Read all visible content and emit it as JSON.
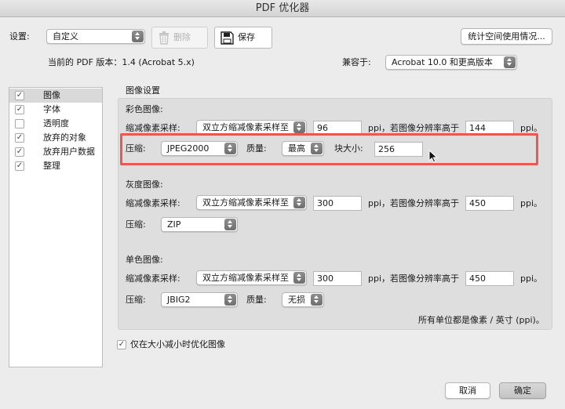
{
  "window": {
    "title": "PDF 优化器"
  },
  "settings": {
    "label": "设置:",
    "value": "自定义",
    "delete_label": "删除",
    "save_label": "保存",
    "audit_button": "统计空间使用情况..."
  },
  "version": {
    "current_text": "当前的 PDF 版本：1.4 (Acrobat 5.x)",
    "compat_label": "兼容于:",
    "compat_value": "Acrobat 10.0 和更高版本"
  },
  "sidebar": {
    "items": [
      {
        "label": "图像",
        "checked": true,
        "selected": true
      },
      {
        "label": "字体",
        "checked": true,
        "selected": false
      },
      {
        "label": "透明度",
        "checked": false,
        "selected": false
      },
      {
        "label": "放弃的对象",
        "checked": true,
        "selected": false
      },
      {
        "label": "放弃用户数据",
        "checked": true,
        "selected": false
      },
      {
        "label": "整理",
        "checked": true,
        "selected": false
      }
    ]
  },
  "image_settings": {
    "title": "图像设置",
    "color": {
      "heading": "彩色图像:",
      "downsample_label": "缩减像素采样:",
      "downsample_value": "双立方缩减像素采样至",
      "ppi_value": "96",
      "ppi_text": "ppi，若图像分辨率高于",
      "above_value": "144",
      "ppi_end": "ppi。",
      "compression_label": "压缩:",
      "compression_value": "JPEG2000",
      "quality_label": "质量:",
      "quality_value": "最高",
      "tile_label": "块大小:",
      "tile_value": "256"
    },
    "gray": {
      "heading": "灰度图像:",
      "downsample_label": "缩减像素采样:",
      "downsample_value": "双立方缩减像素采样至",
      "ppi_value": "300",
      "ppi_text": "ppi，若图像分辨率高于",
      "above_value": "450",
      "ppi_end": "ppi。",
      "compression_label": "压缩:",
      "compression_value": "ZIP"
    },
    "mono": {
      "heading": "单色图像:",
      "downsample_label": "缩减像素采样:",
      "downsample_value": "双立方缩减像素采样至",
      "ppi_value": "300",
      "ppi_text": "ppi，若图像分辨率高于",
      "above_value": "450",
      "ppi_end": "ppi。",
      "compression_label": "压缩:",
      "compression_value": "JBIG2",
      "quality_label": "质量:",
      "quality_value": "无损"
    },
    "units_note": "所有单位都是像素 / 英寸 (ppi)。"
  },
  "optimize_option": {
    "label": "仅在大小减小时优化图像",
    "checked": true
  },
  "footer": {
    "cancel": "取消",
    "ok": "确定"
  },
  "colors": {
    "highlight": "#e55a55",
    "selection": "#d9d9d9"
  }
}
